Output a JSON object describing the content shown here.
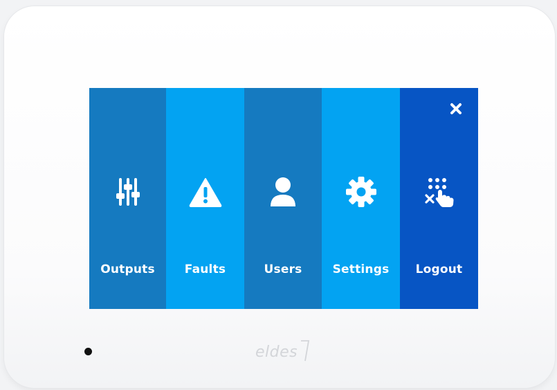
{
  "device": {
    "brand": "eldes"
  },
  "menu": {
    "tiles": [
      {
        "label": "Outputs",
        "icon": "sliders-icon",
        "color": "#157ac0"
      },
      {
        "label": "Faults",
        "icon": "warning-triangle-icon",
        "color": "#03a3f2"
      },
      {
        "label": "Users",
        "icon": "user-icon",
        "color": "#157ac0"
      },
      {
        "label": "Settings",
        "icon": "gear-icon",
        "color": "#03a3f2"
      },
      {
        "label": "Logout",
        "icon": "logout-keypad-icon",
        "color": "#0755c4"
      }
    ],
    "close_icon": "close-icon"
  }
}
